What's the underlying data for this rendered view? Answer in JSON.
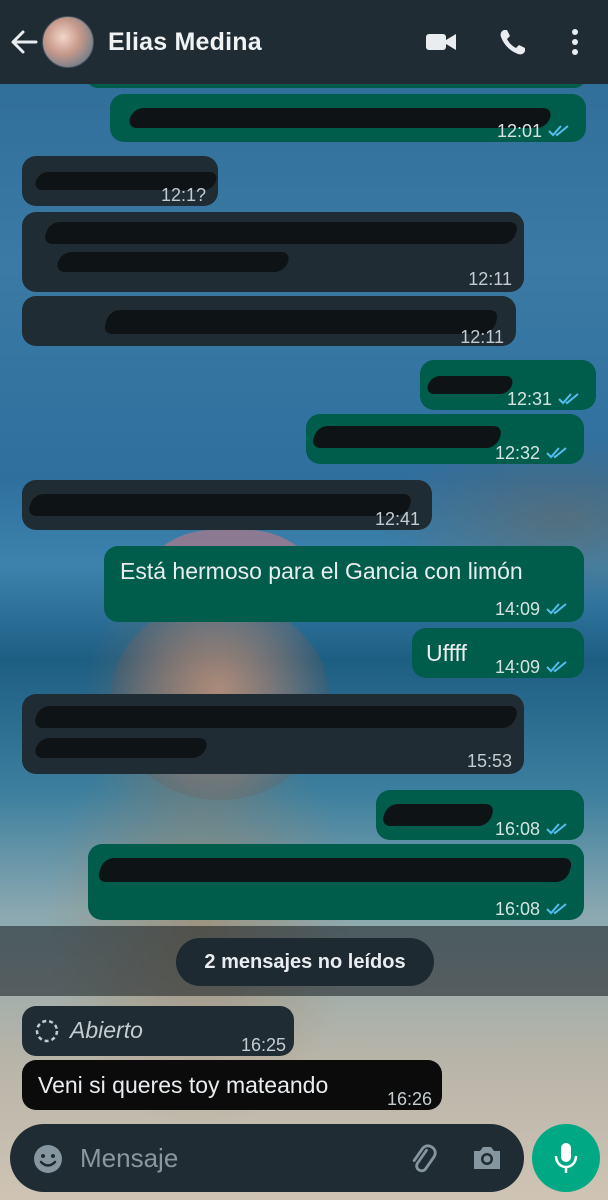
{
  "header": {
    "contact_name": "Elias Medina"
  },
  "icons": {
    "back": "back-arrow-icon",
    "video": "video-call-icon",
    "call": "phone-call-icon",
    "menu": "more-options-icon",
    "emoji": "emoji-icon",
    "attach": "paperclip-icon",
    "camera": "camera-icon",
    "mic": "microphone-icon"
  },
  "colors": {
    "header_bg": "#1f2c34",
    "incoming_bubble": "#1f2c33",
    "outgoing_bubble": "#005c4b",
    "read_ticks": "#53bdeb",
    "mic_button": "#00a884"
  },
  "messages": [
    {
      "dir": "out",
      "time": "12:01",
      "read": true,
      "redacted": true
    },
    {
      "dir": "in",
      "time": "12:1?",
      "redacted": true
    },
    {
      "dir": "in",
      "time": "12:11",
      "redacted": true
    },
    {
      "dir": "in",
      "time": "12:11",
      "redacted": true
    },
    {
      "dir": "out",
      "time": "12:31",
      "read": true,
      "redacted": true
    },
    {
      "dir": "out",
      "time": "12:32",
      "read": true,
      "redacted": true
    },
    {
      "dir": "in",
      "time": "12:41",
      "redacted": true
    },
    {
      "dir": "out",
      "text": "Está hermoso para el Gancia con limón",
      "time": "14:09",
      "read": true
    },
    {
      "dir": "out",
      "text": "Uffff",
      "time": "14:09",
      "read": true
    },
    {
      "dir": "in",
      "time": "15:53",
      "redacted": true
    },
    {
      "dir": "out",
      "time": "16:08",
      "read": true,
      "redacted": true
    },
    {
      "dir": "out",
      "time": "16:08",
      "read": true,
      "redacted": true
    },
    {
      "dir": "in",
      "text": "Abierto",
      "time": "16:25",
      "view_once": true
    },
    {
      "dir": "in",
      "text": "Veni si queres toy mateando",
      "time": "16:26"
    }
  ],
  "unread_divider": "2 mensajes no leídos",
  "composer": {
    "placeholder": "Mensaje"
  }
}
